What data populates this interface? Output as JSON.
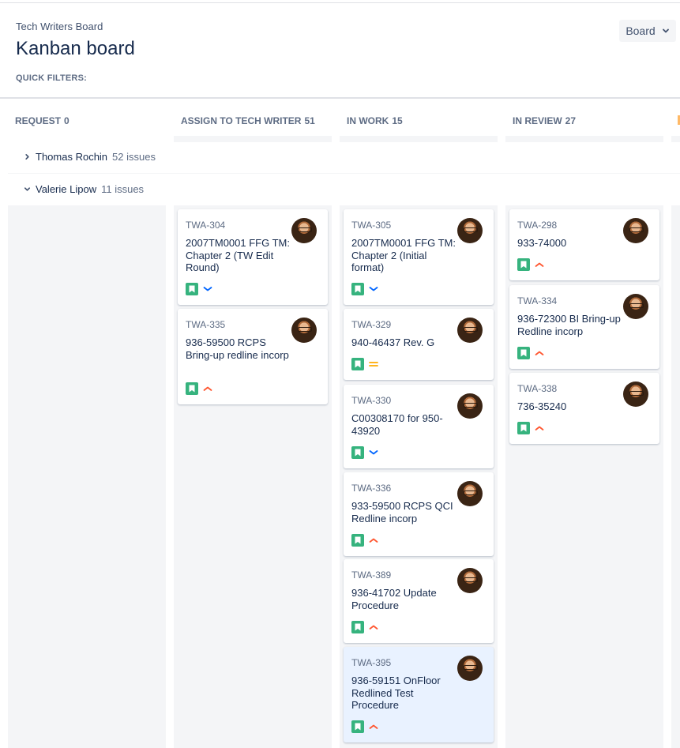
{
  "header": {
    "breadcrumb": "Tech Writers Board",
    "title": "Kanban board",
    "quick_filters_label": "QUICK FILTERS:",
    "board_button_label": "Board"
  },
  "columns": [
    {
      "name": "REQUEST",
      "count": "0"
    },
    {
      "name": "ASSIGN TO TECH WRITER",
      "count": "51"
    },
    {
      "name": "IN WORK",
      "count": "15"
    },
    {
      "name": "IN REVIEW",
      "count": "27"
    }
  ],
  "swimlanes": [
    {
      "name": "Thomas Rochin",
      "count": "52 issues",
      "expanded": false
    },
    {
      "name": "Valerie Lipow",
      "count": "11 issues",
      "expanded": true
    }
  ],
  "colors": {
    "story": "#36b37e",
    "priority_low": "#0065ff",
    "priority_high": "#ff5630",
    "priority_medium": "#ffab00",
    "selected_card": "#e9f2ff"
  },
  "cards": {
    "assign": [
      {
        "key": "TWA-304",
        "summary": "2007TM0001 FFG TM: Chapter 2 (TW Edit Round)",
        "priority": "low-icon"
      },
      {
        "key": "TWA-335",
        "summary": "936-59500 RCPS Bring-up redline incorp",
        "priority": "high-icon"
      }
    ],
    "inwork": [
      {
        "key": "TWA-305",
        "summary": "2007TM0001 FFG TM: Chapter 2 (Initial format)",
        "priority": "low-icon"
      },
      {
        "key": "TWA-329",
        "summary": "940-46437 Rev. G",
        "priority": "medium-icon"
      },
      {
        "key": "TWA-330",
        "summary": "C00308170 for 950-43920",
        "priority": "low-icon"
      },
      {
        "key": "TWA-336",
        "summary": "933-59500 RCPS QCI Redline incorp",
        "priority": "high-icon"
      },
      {
        "key": "TWA-389",
        "summary": "936-41702 Update Procedure",
        "priority": "high-icon"
      },
      {
        "key": "TWA-395",
        "summary": "936-59151 OnFloor Redlined Test Procedure",
        "priority": "high-icon"
      }
    ],
    "review": [
      {
        "key": "TWA-298",
        "summary": "933-74000",
        "priority": "high-icon"
      },
      {
        "key": "TWA-334",
        "summary": "936-72300 BI Bring-up Redline incorp",
        "priority": "high-icon"
      },
      {
        "key": "TWA-338",
        "summary": "736-35240",
        "priority": "high-icon"
      }
    ]
  }
}
